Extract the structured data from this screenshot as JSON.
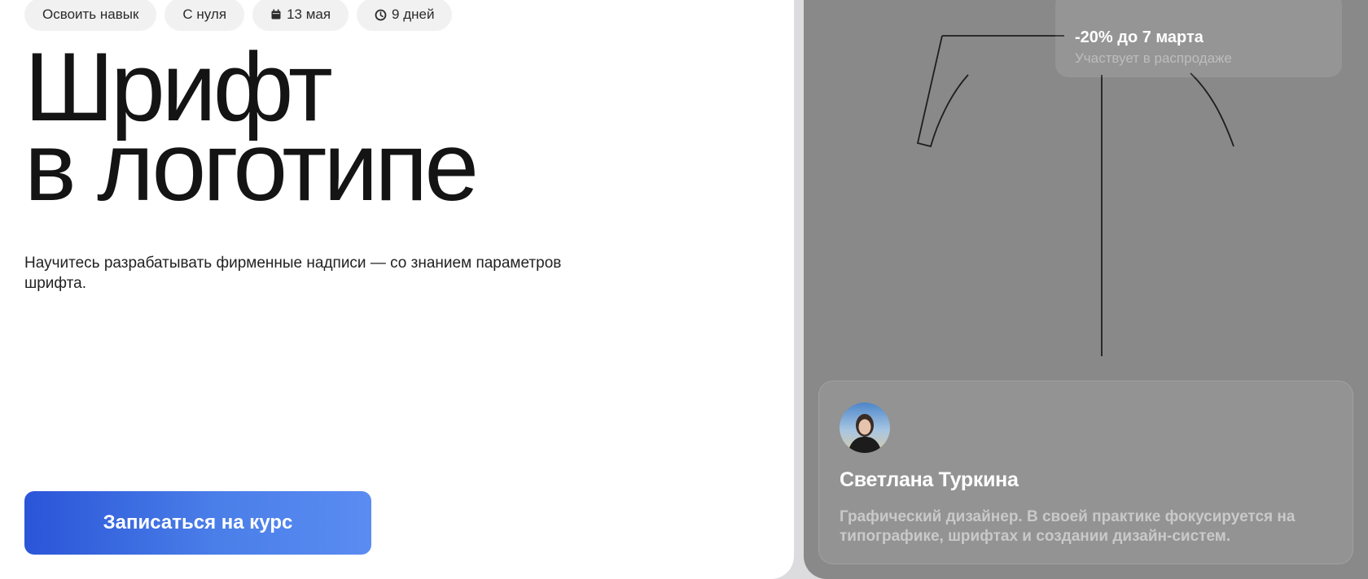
{
  "tags": [
    {
      "label": "Освоить навык",
      "icon": null
    },
    {
      "label": "С нуля",
      "icon": null
    },
    {
      "label": "13 мая",
      "icon": "calendar-icon"
    },
    {
      "label": "9 дней",
      "icon": "clock-icon"
    }
  ],
  "hero": {
    "title_line1": "Шрифт",
    "title_line2": "в логотипе",
    "description": "Научитесь разрабатывать фирменные надписи — со знанием параметров шрифта.",
    "cta_label": "Записаться на курс"
  },
  "promo": {
    "title": "-20% до 7 марта",
    "subtitle": "Участвует в распродаже"
  },
  "author": {
    "name": "Светлана Туркина",
    "bio": "Графический дизайнер. В своей практике фокусируется на типографике, шрифтах и создании дизайн-систем."
  },
  "colors": {
    "cta_gradient_start": "#2a55d8",
    "cta_gradient_end": "#5a8cf2",
    "right_panel_bg": "#898989"
  }
}
